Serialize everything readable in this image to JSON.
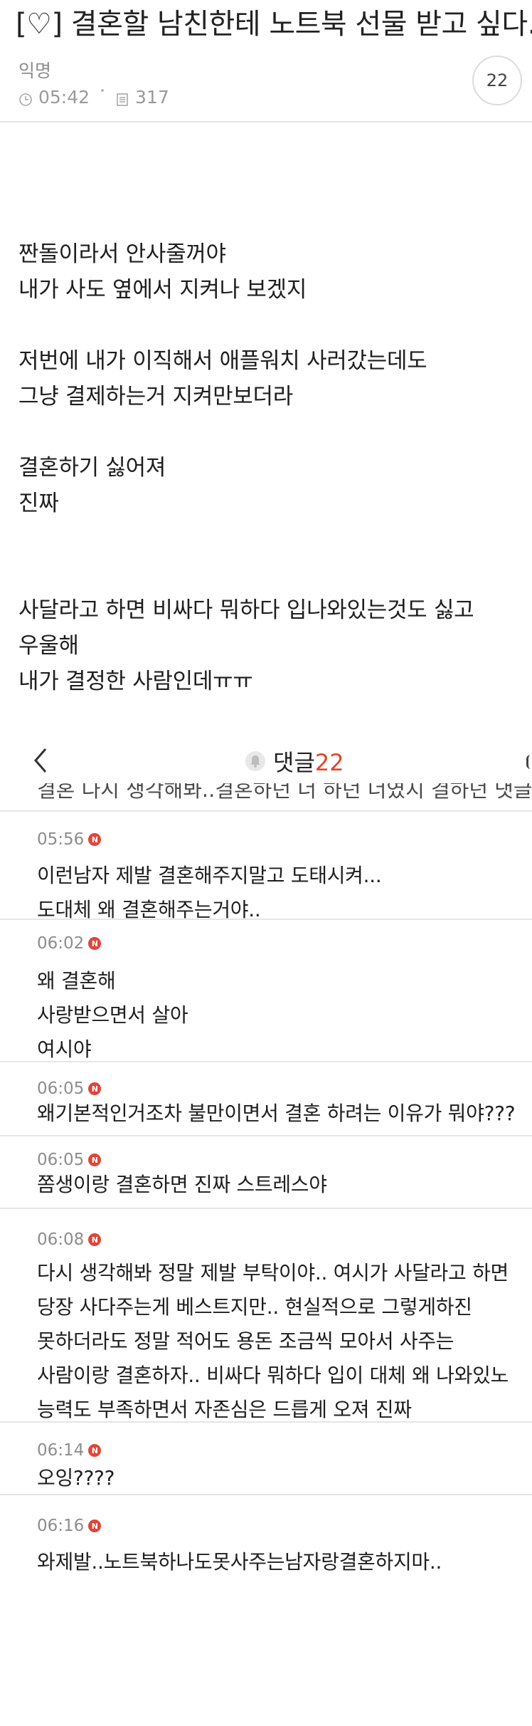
{
  "post": {
    "title": "[♡] 결혼할 남친한테 노트북 선물 받고 싶다..",
    "author": "익명",
    "time": "05:42",
    "views": "317",
    "comment_count": "22",
    "body_lines": [
      "짠돌이라서 안사줄꺼야",
      "내가 사도 옆에서 지켜나 보겠지",
      "",
      "저번에 내가 이직해서 애플워치 사러갔는데도",
      "그냥 결제하는거 지켜만보더라",
      "",
      "결혼하기 싫어져",
      "진짜",
      "",
      "",
      "사달라고 하면 비싸다 뭐하다 입나와있는것도 싫고",
      "우울해",
      "내가 결정한 사람인데ㅠㅠ"
    ]
  },
  "comments_header": {
    "label": "댓글",
    "count": "22"
  },
  "cut_comment_text": "결혼 다시 생각해봐..결혼하던 너 하던 너였지 결하던 댓글",
  "comments": [
    {
      "time": "05:56",
      "badge": "N",
      "lines": [
        "이런남자 제발 결혼해주지말고 도태시켜...",
        "도대체 왜 결혼해주는거야.."
      ]
    },
    {
      "time": "06:02",
      "badge": "N",
      "lines": [
        "왜 결혼해",
        "사랑받으면서 살아",
        "여시야"
      ]
    },
    {
      "time": "06:05",
      "badge": "N",
      "lines": [
        "왜기본적인거조차 불만이면서 결혼 하려는 이유가 뭐야???"
      ]
    },
    {
      "time": "06:05",
      "badge": "N",
      "lines": [
        "쫌생이랑 결혼하면 진짜 스트레스야"
      ]
    },
    {
      "time": "06:08",
      "badge": "N",
      "lines": [
        "다시 생각해봐 정말 제발 부탁이야.. 여시가 사달라고 하면",
        "당장 사다주는게 베스트지만.. 현실적으로 그렇게하진",
        "못하더라도 정말 적어도 용돈 조금씩 모아서 사주는",
        "사람이랑 결혼하자.. 비싸다 뭐하다 입이 대체 왜 나와있노",
        "능력도 부족하면서 자존심은 드릅게 오져 진짜"
      ]
    },
    {
      "time": "06:14",
      "badge": "N",
      "lines": [
        "오잉????"
      ]
    },
    {
      "time": "06:16",
      "badge": "N",
      "lines": [
        "와제발..노트북하나도못사주는남자랑결혼하지마.."
      ]
    }
  ]
}
